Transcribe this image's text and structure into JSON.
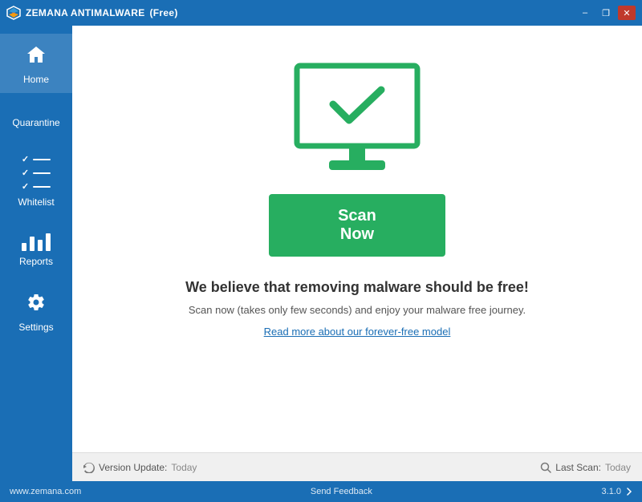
{
  "titleBar": {
    "appName": "ZEMANA ANTIMALWARE",
    "edition": "(Free)",
    "controls": {
      "minimize": "–",
      "maximize": "❐",
      "close": "✕"
    }
  },
  "sidebar": {
    "items": [
      {
        "id": "home",
        "label": "Home",
        "active": true
      },
      {
        "id": "quarantine",
        "label": "Quarantine",
        "active": false
      },
      {
        "id": "whitelist",
        "label": "Whitelist",
        "active": false
      },
      {
        "id": "reports",
        "label": "Reports",
        "active": false
      },
      {
        "id": "settings",
        "label": "Settings",
        "active": false
      }
    ]
  },
  "main": {
    "scanButton": "Scan Now",
    "headline": "We believe that removing malware should be free!",
    "subtext": "Scan now (takes only few seconds) and enjoy your malware free journey.",
    "link": "Read more about our forever-free model"
  },
  "statusBar": {
    "versionLabel": "Version Update:",
    "versionValue": "Today",
    "lastScanLabel": "Last Scan:",
    "lastScanValue": "Today"
  },
  "footer": {
    "website": "www.zemana.com",
    "feedback": "Send Feedback",
    "version": "3.1.0"
  }
}
